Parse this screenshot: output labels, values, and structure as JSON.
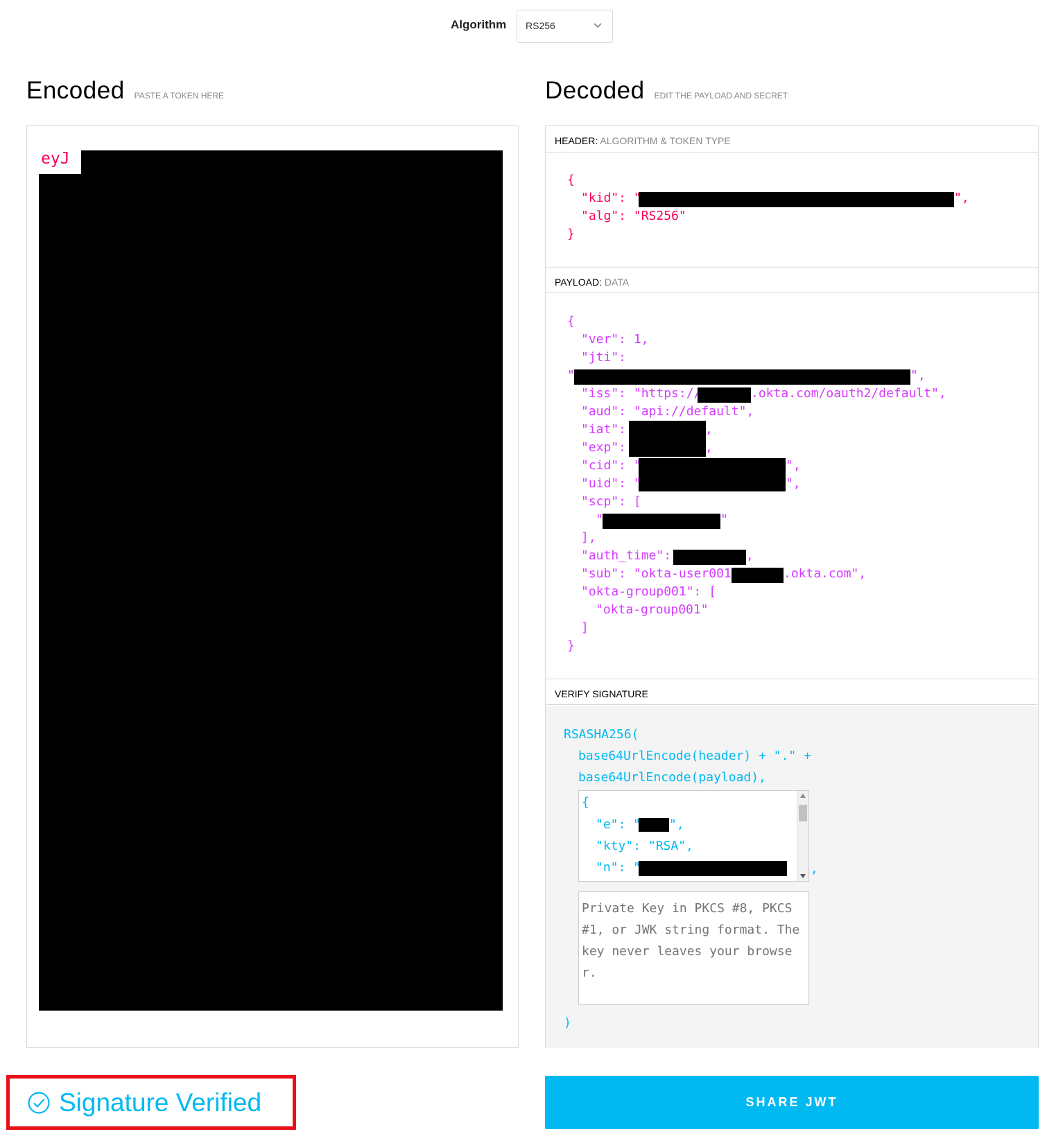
{
  "algorithm": {
    "label": "Algorithm",
    "value": "RS256"
  },
  "encoded": {
    "title": "Encoded",
    "subtitle": "PASTE A TOKEN HERE",
    "token_start": "eyJ"
  },
  "decoded": {
    "title": "Decoded",
    "subtitle": "EDIT THE PAYLOAD AND SECRET",
    "header_section": {
      "label": "HEADER:",
      "sublabel": "ALGORITHM & TOKEN TYPE"
    },
    "payload_section": {
      "label": "PAYLOAD:",
      "sublabel": "DATA"
    },
    "verify_section": {
      "label": "VERIFY SIGNATURE"
    }
  },
  "header_json": {
    "open": "{",
    "kid_key": "\"kid\": \"",
    "kid_end": "\",",
    "alg_line": "\"alg\": \"RS256\"",
    "close": "}"
  },
  "payload_json": {
    "open": "{",
    "ver": "\"ver\": 1,",
    "jti_key": "\"jti\":",
    "jti_quote": "\"",
    "jti_end": "\",",
    "iss_key": "\"iss\": \"https://",
    "iss_end": ".okta.com/oauth2/default\",",
    "aud": "\"aud\": \"api://default\",",
    "iat_key": "\"iat\":",
    "iat_end": ",",
    "exp_key": "\"exp\":",
    "exp_end": ",",
    "cid_key": "\"cid\": \"",
    "cid_end": "\",",
    "uid_key": "\"uid\": \"",
    "uid_end": "\",",
    "scp_key": "\"scp\": [",
    "scp_item_quote": "\"",
    "scp_item_end": "\"",
    "scp_close": "],",
    "auth_time_key": "\"auth_time\":",
    "auth_time_end": ",",
    "sub_key": "\"sub\": \"okta-user001@",
    "sub_end": ".okta.com\",",
    "group_key": "\"okta-group001\": [",
    "group_item": "\"okta-group001\"",
    "group_close": "]",
    "close": "}"
  },
  "verify": {
    "fn_open": "RSASHA256(",
    "line1": "base64UrlEncode(header) + \".\" +",
    "line2": "base64UrlEncode(payload),",
    "pub_open": "{",
    "e_key": "\"e\": \"",
    "e_end": "\",",
    "kty": "\"kty\": \"RSA\",",
    "n_key": "\"n\": \"",
    "after_pub": ",",
    "private_placeholder": "Private Key in PKCS #8, PKCS #1, or JWK string format. The key never leaves your browser.",
    "fn_close": ")"
  },
  "status": {
    "text": "Signature Verified"
  },
  "share": {
    "label": "SHARE JWT"
  },
  "colors": {
    "accent": "#00b9f1",
    "header_pink": "#fb015b",
    "payload_purple": "#d63aff",
    "highlight_red": "#e8111a"
  }
}
